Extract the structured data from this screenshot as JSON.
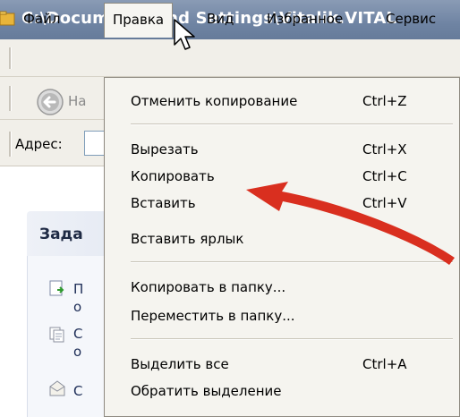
{
  "window": {
    "title": "C:\\Documents and Settings\\Vitalik.VITAL"
  },
  "menubar": {
    "items": [
      {
        "label": "Файл"
      },
      {
        "label": "Правка"
      },
      {
        "label": "Вид"
      },
      {
        "label": "Избранное"
      },
      {
        "label": "Сервис"
      }
    ],
    "open_menu": "Правка"
  },
  "toolbar": {
    "back_label_partial": "На"
  },
  "address": {
    "label": "Адрес:"
  },
  "taskpane": {
    "title_partial": "Зада",
    "rows": [
      {
        "icon": "folder-add-icon",
        "letter1": "П",
        "letter2": "о"
      },
      {
        "icon": "copy-doc-icon",
        "letter1": "С",
        "letter2": "о"
      },
      {
        "icon": "mail-icon",
        "letter1": "С",
        "letter2": ""
      }
    ]
  },
  "edit_menu": {
    "groups": [
      [
        {
          "label": "Отменить копирование",
          "shortcut": "Ctrl+Z"
        }
      ],
      [
        {
          "label": "Вырезать",
          "shortcut": "Ctrl+X"
        },
        {
          "label": "Копировать",
          "shortcut": "Ctrl+C"
        },
        {
          "label": "Вставить",
          "shortcut": "Ctrl+V"
        },
        {
          "label": "Вставить ярлык",
          "shortcut": ""
        }
      ],
      [
        {
          "label": "Копировать в папку...",
          "shortcut": ""
        },
        {
          "label": "Переместить в папку...",
          "shortcut": ""
        }
      ],
      [
        {
          "label": "Выделить все",
          "shortcut": "Ctrl+A"
        },
        {
          "label": "Обратить выделение",
          "shortcut": ""
        }
      ]
    ]
  },
  "annotation": {
    "arrow_color": "#d92f1f",
    "points_to": "Копировать"
  }
}
